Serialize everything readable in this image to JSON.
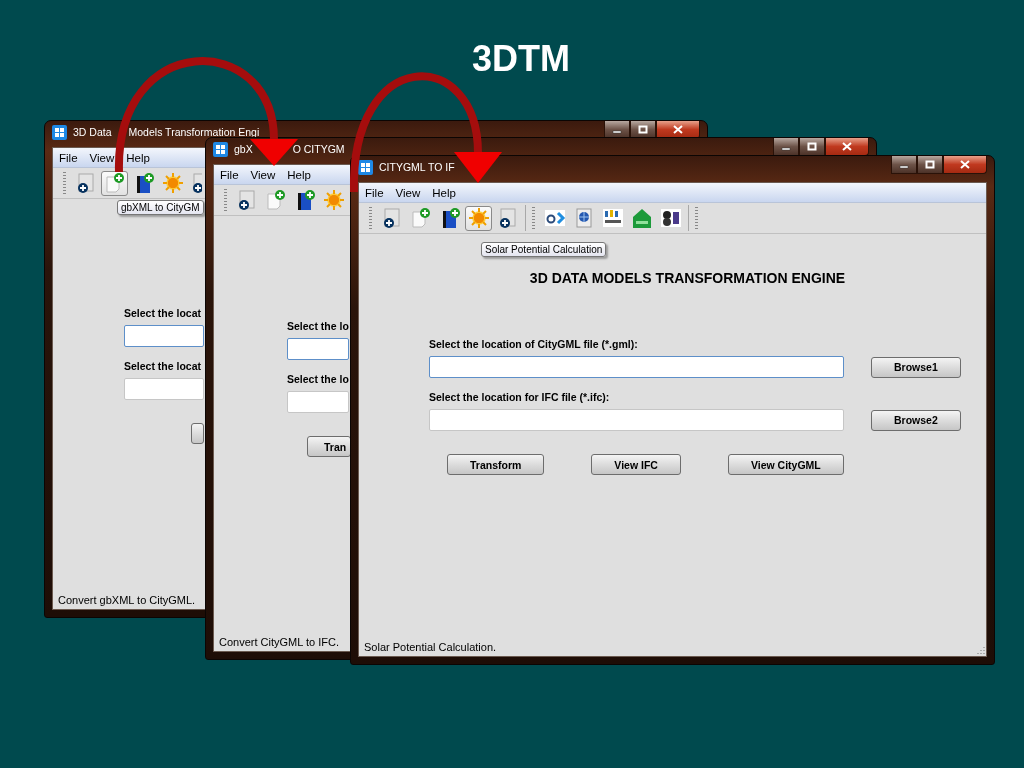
{
  "slide_title": "3DTM",
  "windows": [
    {
      "title_parts": [
        "3D Data",
        "Models Transformation Engi"
      ],
      "menu": [
        "File",
        "View",
        "Help"
      ],
      "toolbar_groups": [
        [
          {
            "kind": "new",
            "selected": false
          },
          {
            "kind": "doc_plus",
            "selected": true
          },
          {
            "kind": "book_plus",
            "selected": false
          },
          {
            "kind": "sun",
            "selected": false
          },
          {
            "kind": "new",
            "selected": false
          }
        ]
      ],
      "tooltip": "gbXML to CityGM",
      "fields": [
        {
          "label": "Select the locat",
          "focused": true
        },
        {
          "label": "Select the locat",
          "focused": false
        }
      ],
      "buttons": [
        {
          "kind": "blank"
        }
      ],
      "status": "Convert gbXML to CityGML."
    },
    {
      "title_parts": [
        "gbX",
        "O CITYGM"
      ],
      "menu": [
        "File",
        "View",
        "Help"
      ],
      "toolbar_groups": [
        [
          {
            "kind": "new",
            "selected": false
          },
          {
            "kind": "doc_plus",
            "selected": false
          },
          {
            "kind": "book_plus",
            "selected": false
          },
          {
            "kind": "sun",
            "selected": false
          }
        ]
      ],
      "fields": [
        {
          "label": "Select the lo",
          "focused": true
        },
        {
          "label": "Select the lo",
          "focused": false
        }
      ],
      "buttons": [
        {
          "kind": "text",
          "label": "Tran"
        }
      ],
      "status": "Convert CityGML to IFC."
    },
    {
      "title_parts": [
        "CITYGML TO IF"
      ],
      "menu": [
        "File",
        "View",
        "Help"
      ],
      "toolbar_groups": [
        [
          {
            "kind": "new",
            "selected": false
          },
          {
            "kind": "doc_plus",
            "selected": false
          },
          {
            "kind": "book_plus",
            "selected": false
          },
          {
            "kind": "sun",
            "selected": true
          },
          {
            "kind": "new",
            "selected": false
          }
        ],
        [
          {
            "kind": "doe",
            "selected": false
          },
          {
            "kind": "globe",
            "selected": false
          },
          {
            "kind": "citygml",
            "selected": false
          },
          {
            "kind": "gbxml",
            "selected": false
          },
          {
            "kind": "ifc",
            "selected": false
          }
        ]
      ],
      "tooltip": "Solar Potential Calculation",
      "heading": "3D DATA MODELS TRANSFORMATION ENGINE",
      "fields": [
        {
          "label": "Select the location of CityGML file (*.gml):",
          "focused": true,
          "button": "Browse1"
        },
        {
          "label": "Select the location for IFC file (*.ifc):",
          "focused": false,
          "button": "Browse2"
        }
      ],
      "buttons": [
        {
          "kind": "text",
          "label": "Transform"
        },
        {
          "kind": "text",
          "label": "View IFC"
        },
        {
          "kind": "text",
          "label": "View CityGML"
        }
      ],
      "status": "Solar Potential Calculation."
    }
  ]
}
